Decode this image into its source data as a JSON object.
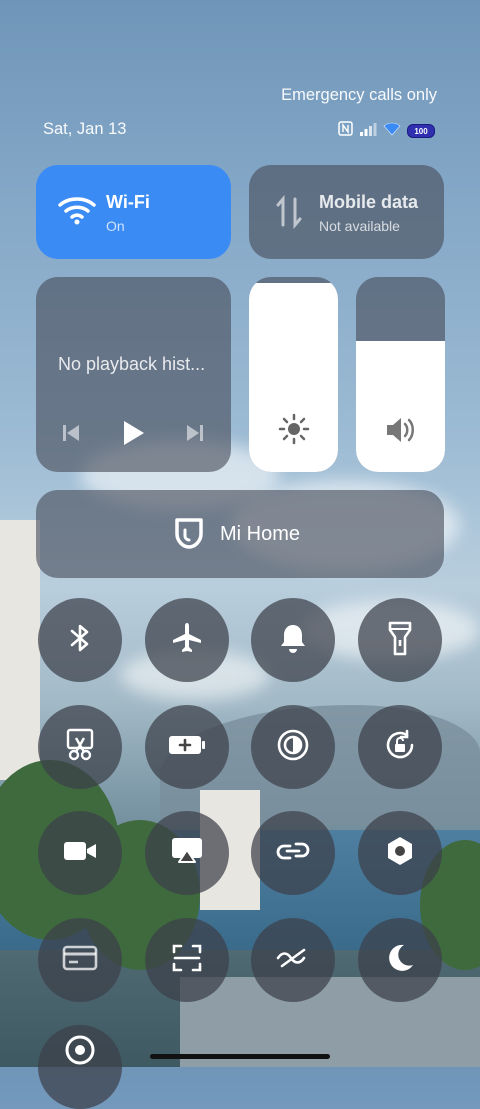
{
  "status_bar": {
    "carrier_text": "Emergency calls only",
    "date": "Sat, Jan 13",
    "battery_level": "100"
  },
  "tiles": {
    "wifi": {
      "title": "Wi-Fi",
      "subtitle": "On"
    },
    "mobile_data": {
      "title": "Mobile data",
      "subtitle": "Not available"
    }
  },
  "media": {
    "text": "No playback hist..."
  },
  "sliders": {
    "brightness_level": 0.97,
    "volume_level": 0.67
  },
  "mi_home": {
    "label": "Mi Home"
  },
  "toggles": [
    "bluetooth-icon",
    "airplane-icon",
    "bell-icon",
    "flashlight-icon",
    "screenshot-icon",
    "battery-saver-icon",
    "reading-mode-icon",
    "auto-rotate-icon",
    "video-camera-icon",
    "cast-icon",
    "link-icon",
    "settings-icon",
    "card-icon",
    "scan-icon",
    "sync-icon",
    "dark-mode-icon",
    "lens-icon"
  ],
  "colors": {
    "accent": "#3b8bf5",
    "tile_bg": "#484e5a"
  }
}
